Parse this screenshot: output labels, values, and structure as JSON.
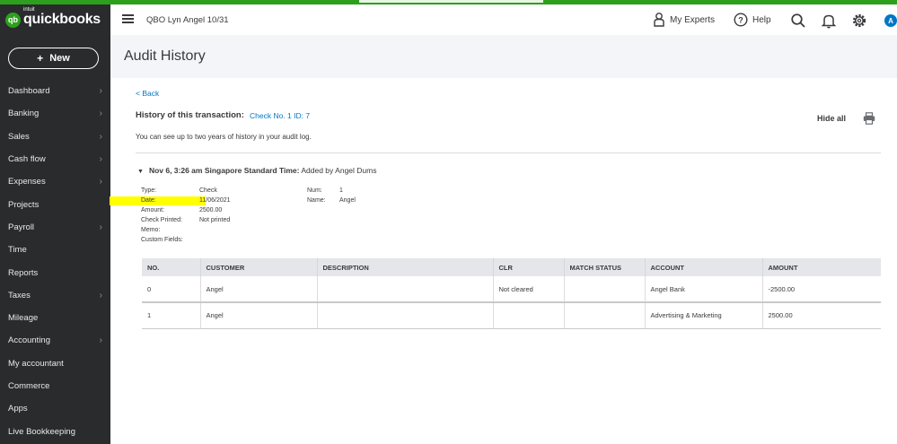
{
  "app": {
    "logo_intuit": "intuit",
    "logo_name": "quickbooks",
    "logo_badge": "qb",
    "company": "QBO Lyn Angel 10/31",
    "brand_color": "#2ca01c"
  },
  "sidebar": {
    "new_label": "New",
    "items": [
      {
        "label": "Dashboard",
        "chevron": true
      },
      {
        "label": "Banking",
        "chevron": true
      },
      {
        "label": "Sales",
        "chevron": true
      },
      {
        "label": "Cash flow",
        "chevron": true
      },
      {
        "label": "Expenses",
        "chevron": true
      },
      {
        "label": "Projects",
        "chevron": false
      },
      {
        "label": "Payroll",
        "chevron": true
      },
      {
        "label": "Time",
        "chevron": false
      },
      {
        "label": "Reports",
        "chevron": false
      },
      {
        "label": "Taxes",
        "chevron": true
      },
      {
        "label": "Mileage",
        "chevron": false
      },
      {
        "label": "Accounting",
        "chevron": true
      },
      {
        "label": "My accountant",
        "chevron": false
      },
      {
        "label": "Commerce",
        "chevron": false
      },
      {
        "label": "Apps",
        "chevron": false
      },
      {
        "label": "Live Bookkeeping",
        "chevron": false
      }
    ]
  },
  "header": {
    "my_experts": "My Experts",
    "help": "Help",
    "avatar_letter": "A"
  },
  "page": {
    "title": "Audit History",
    "back": "< Back",
    "history_label": "History of this transaction:",
    "history_link": "Check No. 1 ID: 7",
    "hide_all": "Hide all",
    "note": "You can see up to two years of history in your audit log."
  },
  "entry": {
    "date_bold": "Nov 6, 3:26 am Singapore Standard Time:",
    "action": " Added by Angel Dums",
    "fields_left": [
      {
        "label": "Type:",
        "value": "Check"
      },
      {
        "label": "Date:",
        "value": "11/06/2021"
      },
      {
        "label": "Amount:",
        "value": "2500.00"
      },
      {
        "label": "Check Printed:",
        "value": "Not printed"
      },
      {
        "label": "Memo:",
        "value": ""
      },
      {
        "label": "Custom Fields:",
        "value": ""
      }
    ],
    "fields_right": [
      {
        "label": "Num:",
        "value": "1"
      },
      {
        "label": "Name:",
        "value": "Angel"
      }
    ]
  },
  "table": {
    "headers": [
      "NO.",
      "CUSTOMER",
      "DESCRIPTION",
      "CLR",
      "MATCH STATUS",
      "ACCOUNT",
      "AMOUNT"
    ],
    "rows": [
      [
        "0",
        "Angel",
        "",
        "Not cleared",
        "",
        "Angel Bank",
        "-2500.00"
      ],
      [
        "1",
        "Angel",
        "",
        "",
        "",
        "Advertising & Marketing",
        "2500.00"
      ]
    ]
  }
}
